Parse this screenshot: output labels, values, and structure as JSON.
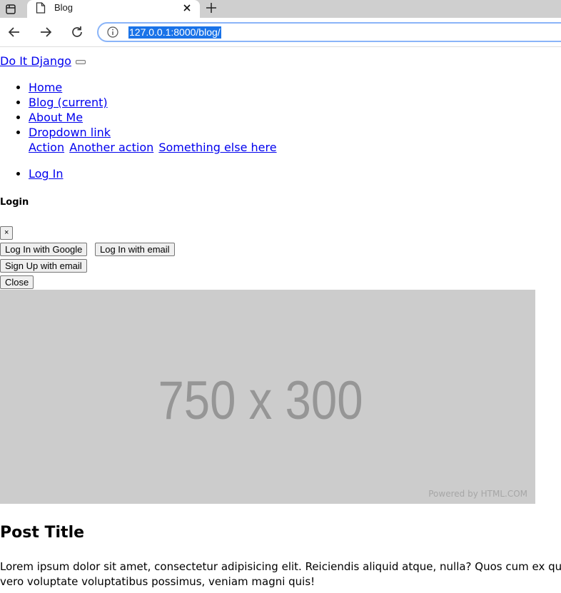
{
  "browser": {
    "tab_title": "Blog",
    "url": "127.0.0.1:8000/blog/"
  },
  "navbar": {
    "brand": "Do It Django",
    "items": [
      {
        "label": "Home"
      },
      {
        "label": "Blog (current)"
      },
      {
        "label": "About Me"
      },
      {
        "label": "Dropdown link"
      }
    ],
    "dropdown": [
      "Action",
      "Another action",
      "Something else here"
    ],
    "login": "Log In"
  },
  "modal": {
    "title": "Login",
    "close_x": "×",
    "google_button": "Log In with Google",
    "email_login_button": "Log In with email",
    "signup_button": "Sign Up with email",
    "close_button": "Close"
  },
  "hero": {
    "placeholder_text": "750 x 300",
    "credit": "Powered by HTML.COM",
    "bg_color": "#cccccc"
  },
  "post": {
    "title": "Post Title",
    "body_line1": "Lorem ipsum dolor sit amet, consectetur adipisicing elit. Reiciendis aliquid atque, nulla? Quos cum ex quis s",
    "body_line2": "vero voluptate voluptatibus possimus, veniam magni quis!"
  },
  "icons": {
    "tab_switcher": "tab-switcher-icon",
    "favicon": "page-icon",
    "tab_close": "close-icon",
    "new_tab": "plus-icon",
    "back": "back-arrow-icon",
    "forward": "forward-arrow-icon",
    "reload": "reload-icon",
    "site_info": "info-icon"
  },
  "colors": {
    "link": "#0000ee",
    "url_highlight": "#1a73e8"
  }
}
